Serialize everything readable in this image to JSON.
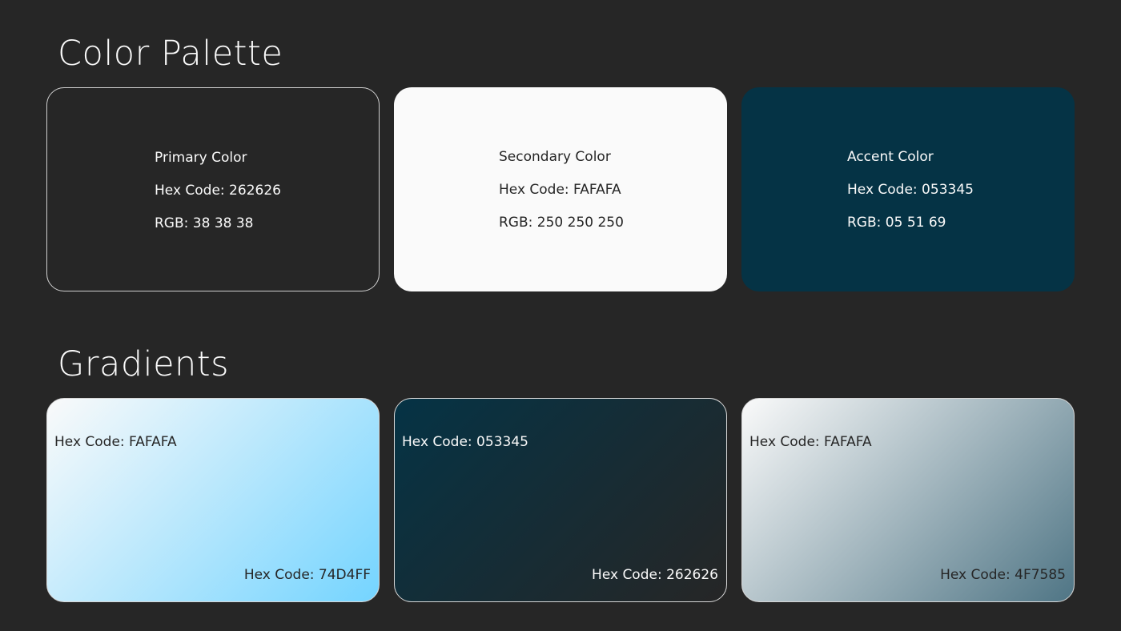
{
  "sections": {
    "palette_title": "Color Palette",
    "gradients_title": "Gradients"
  },
  "palette": [
    {
      "name": "Primary Color",
      "hex_label": "Hex Code: 262626",
      "rgb_label": "RGB: 38 38 38",
      "color": "#262626",
      "text_color": "#FAFAFA"
    },
    {
      "name": "Secondary Color",
      "hex_label": "Hex Code: FAFAFA",
      "rgb_label": "RGB: 250 250 250",
      "color": "#FAFAFA",
      "text_color": "#262626"
    },
    {
      "name": "Accent Color",
      "hex_label": "Hex Code: 053345",
      "rgb_label": "RGB: 05 51 69",
      "color": "#053345",
      "text_color": "#FAFAFA"
    }
  ],
  "gradients": [
    {
      "start_label": "Hex Code: FAFAFA",
      "end_label": "Hex Code: 74D4FF",
      "start_color": "#FAFAFA",
      "end_color": "#74D4FF",
      "text_color": "#262626"
    },
    {
      "start_label": "Hex Code: 053345",
      "end_label": "Hex Code: 262626",
      "start_color": "#053345",
      "end_color": "#262626",
      "text_color": "#FAFAFA"
    },
    {
      "start_label": "Hex Code: FAFAFA",
      "end_label": "Hex Code: 4F7585",
      "start_color": "#FAFAFA",
      "end_color": "#4F7585",
      "text_color": "#262626"
    }
  ]
}
